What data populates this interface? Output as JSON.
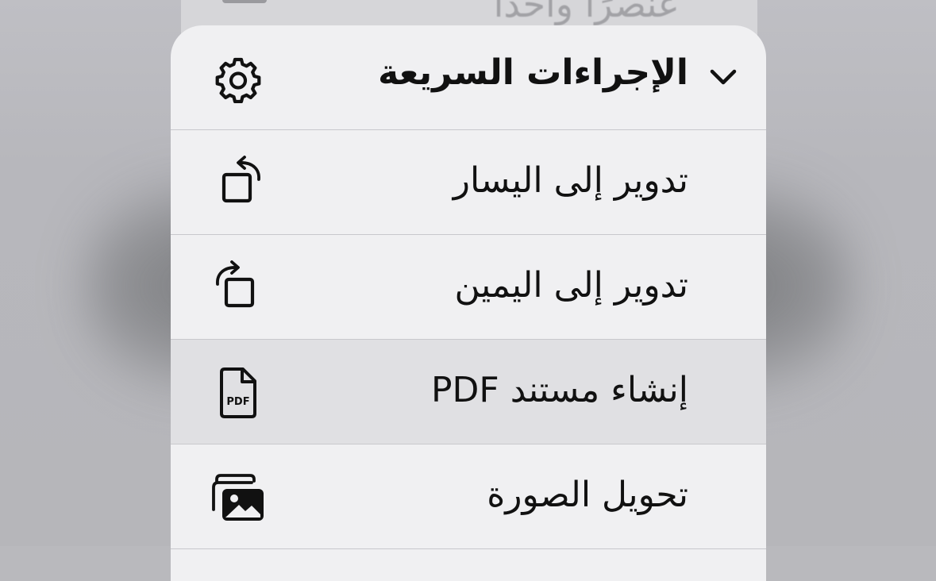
{
  "background": {
    "partial_text": "عنصرًا واحدًا"
  },
  "menu": {
    "header": {
      "title": "الإجراءات السريعة",
      "chevron_icon": "chevron-down-icon",
      "settings_icon": "gear-icon"
    },
    "items": [
      {
        "label": "تدوير إلى اليسار",
        "icon": "rotate-left-icon",
        "highlighted": false
      },
      {
        "label": "تدوير إلى اليمين",
        "icon": "rotate-right-icon",
        "highlighted": false
      },
      {
        "label": "إنشاء مستند PDF",
        "icon": "pdf-document-icon",
        "icon_text": "PDF",
        "highlighted": true
      },
      {
        "label": "تحويل الصورة",
        "icon": "photos-icon",
        "highlighted": false
      }
    ]
  },
  "colors": {
    "menu_background": "#f0f0f2",
    "highlight": "#e0e0e3",
    "separator": "#c8c8cc",
    "text": "#111111"
  }
}
